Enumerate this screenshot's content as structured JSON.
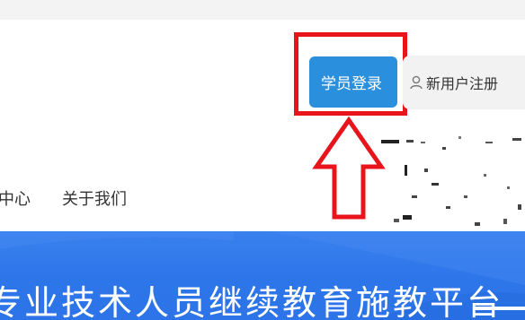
{
  "header": {
    "login_label": "学员登录",
    "register_label": "新用户注册"
  },
  "nav": {
    "items": [
      {
        "label": "中心"
      },
      {
        "label": "关于我们"
      }
    ]
  },
  "banner": {
    "title": "专业技术人员继续教育施教平台"
  },
  "colors": {
    "accent_blue": "#2a8fdc",
    "annotation_red": "#e8141c",
    "banner_blue": "#2c74e8"
  },
  "icons": {
    "register": "user-icon",
    "annotation": "up-arrow-icon"
  }
}
